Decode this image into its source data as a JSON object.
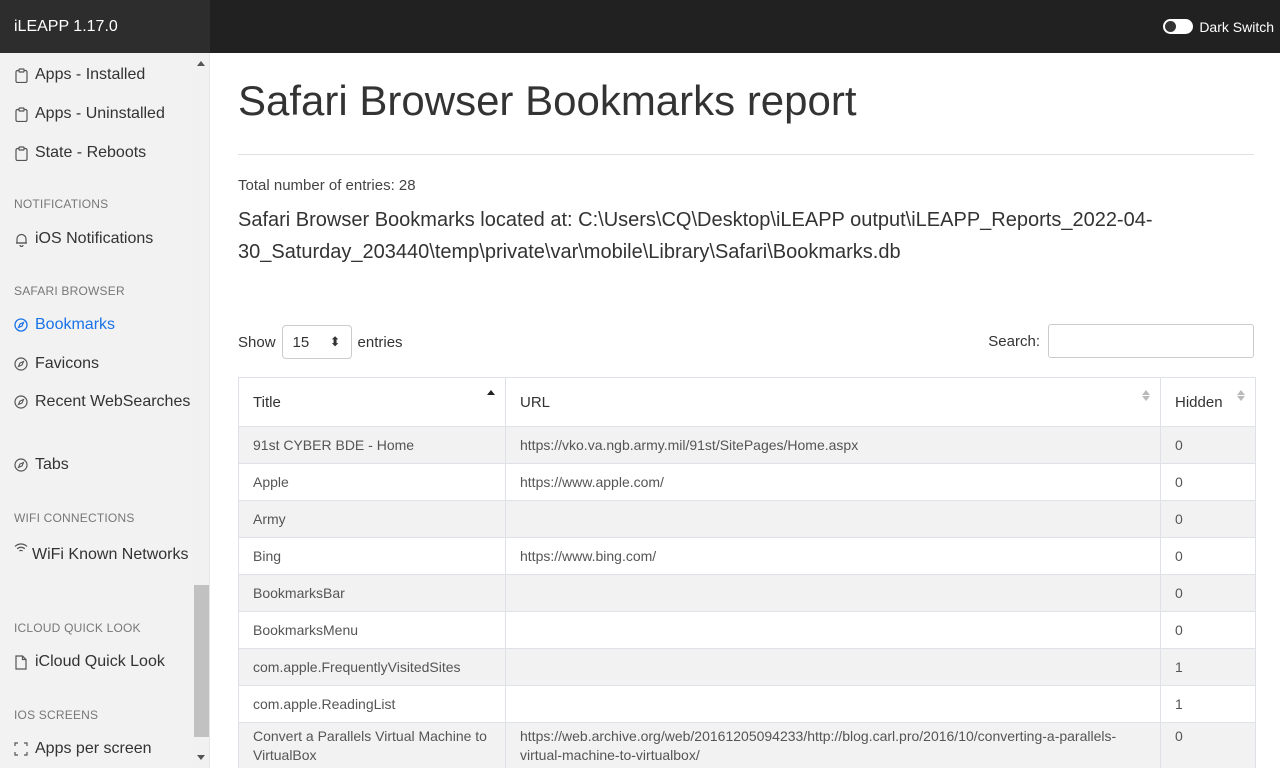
{
  "app": {
    "title": "iLEAPP 1.17.0",
    "dark_switch_label": "Dark Switch"
  },
  "sidebar": {
    "items": [
      {
        "label": "Apps - Installed",
        "icon": "clipboard-icon"
      },
      {
        "label": "Apps - Uninstalled",
        "icon": "clipboard-icon"
      },
      {
        "label": "State - Reboots",
        "icon": "clipboard-icon"
      },
      {
        "label": "iOS Notifications",
        "icon": "bell-icon"
      },
      {
        "label": "Bookmarks",
        "icon": "compass-icon",
        "active": true
      },
      {
        "label": "Favicons",
        "icon": "compass-icon"
      },
      {
        "label": "Recent WebSearches",
        "icon": "compass-icon"
      },
      {
        "label": "Tabs",
        "icon": "compass-icon"
      },
      {
        "label": "WiFi Known Networks",
        "icon": "wifi-icon"
      },
      {
        "label": "iCloud Quick Look",
        "icon": "file-icon"
      },
      {
        "label": "Apps per screen",
        "icon": "frame-icon"
      }
    ],
    "headers": {
      "notifications": "NOTIFICATIONS",
      "safari": "SAFARI BROWSER",
      "wifi": "WIFI CONNECTIONS",
      "icloud": "ICLOUD QUICK LOOK",
      "screens": "IOS SCREENS"
    }
  },
  "main": {
    "title": "Safari Browser Bookmarks report",
    "total": "Total number of entries: 28",
    "location": "Safari Browser Bookmarks located at: C:\\Users\\CQ\\Desktop\\iLEAPP output\\iLEAPP_Reports_2022-04-30_Saturday_203440\\temp\\private\\var\\mobile\\Library\\Safari\\Bookmarks.db",
    "show_label": "Show",
    "show_value": "15",
    "entries_label": "entries",
    "search_label": "Search:",
    "search_value": ""
  },
  "table": {
    "headers": [
      "Title",
      "URL",
      "Hidden"
    ],
    "rows": [
      [
        "91st CYBER BDE - Home",
        "https://vko.va.ngb.army.mil/91st/SitePages/Home.aspx",
        "0"
      ],
      [
        "Apple",
        "https://www.apple.com/",
        "0"
      ],
      [
        "Army",
        "",
        "0"
      ],
      [
        "Bing",
        "https://www.bing.com/",
        "0"
      ],
      [
        "BookmarksBar",
        "",
        "0"
      ],
      [
        "BookmarksMenu",
        "",
        "0"
      ],
      [
        "com.apple.FrequentlyVisitedSites",
        "",
        "1"
      ],
      [
        "com.apple.ReadingList",
        "",
        "1"
      ],
      [
        "Convert a Parallels Virtual Machine to VirtualBox",
        "https://web.archive.org/web/20161205094233/http://blog.carl.pro/2016/10/converting-a-parallels-virtual-machine-to-virtualbox/",
        "0"
      ]
    ]
  },
  "colors": {
    "topbar": "#212121",
    "active_link": "#1a73e8",
    "sidebar_bg": "#f2f2f2"
  }
}
